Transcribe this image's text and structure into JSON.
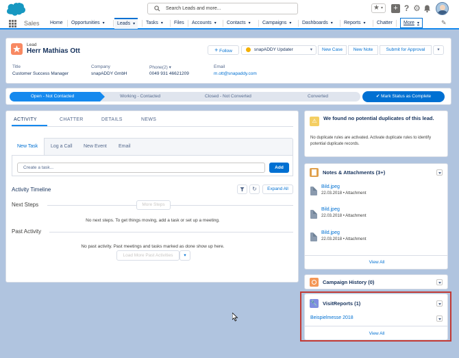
{
  "header": {
    "search_placeholder": "Search Leads and more...",
    "app_name": "Sales"
  },
  "nav": [
    {
      "label": "Home",
      "chevron": false
    },
    {
      "label": "Opportunities",
      "chevron": true
    },
    {
      "label": "Leads",
      "chevron": true,
      "active": true
    },
    {
      "label": "Tasks",
      "chevron": true
    },
    {
      "label": "Files",
      "chevron": false
    },
    {
      "label": "Accounts",
      "chevron": true
    },
    {
      "label": "Contacts",
      "chevron": true
    },
    {
      "label": "Campaigns",
      "chevron": true
    },
    {
      "label": "Dashboards",
      "chevron": true
    },
    {
      "label": "Reports",
      "chevron": true
    },
    {
      "label": "Chatter",
      "chevron": false
    },
    {
      "label": "More",
      "chevron": true
    }
  ],
  "record": {
    "type_label": "Lead",
    "name": "Herr Mathias Ott",
    "actions": {
      "follow": "Follow",
      "snapaddy": "snapADDY Updater",
      "new_case": "New Case",
      "new_note": "New Note",
      "submit": "Submit for Approval"
    },
    "fields": {
      "title_label": "Title",
      "title_value": "Customer Success Manager",
      "company_label": "Company",
      "company_value": "snapADDY GmbH",
      "phone_label": "Phone(2)",
      "phone_value": "0049 931 46621209",
      "email_label": "Email",
      "email_value": "m.ott@snapaddy.com"
    }
  },
  "path": {
    "steps": [
      "Open - Not Contacted",
      "Working - Contacted",
      "Closed - Not Converted",
      "Converted"
    ],
    "active_index": 0,
    "mark_button": "Mark Status as Complete"
  },
  "activity": {
    "tabs": [
      "ACTIVITY",
      "CHATTER",
      "DETAILS",
      "NEWS"
    ],
    "subtabs": [
      "New Task",
      "Log a Call",
      "New Event",
      "Email"
    ],
    "task_placeholder": "Create a task...",
    "add_button": "Add",
    "timeline_title": "Activity Timeline",
    "expand_all": "Expand All",
    "next_steps_title": "Next Steps",
    "more_steps": "More Steps",
    "no_next_steps": "No next steps. To get things moving, add a task or set up a meeting.",
    "past_activity_title": "Past Activity",
    "no_past_activity": "No past activity. Past meetings and tasks marked as done show up here.",
    "load_more": "Load More Past Activities"
  },
  "duplicates": {
    "title": "We found no potential duplicates of this lead.",
    "body": "No duplicate rules are activated. Activate duplicate rules to identify potential duplicate records."
  },
  "notes": {
    "title": "Notes & Attachments (3+)",
    "items": [
      {
        "name": "Bild.jpeg",
        "meta": "22.03.2018 • Attachment"
      },
      {
        "name": "Bild.jpeg",
        "meta": "22.03.2018 • Attachment"
      },
      {
        "name": "Bild.jpeg",
        "meta": "22.03.2018 • Attachment"
      }
    ],
    "view_all": "View All"
  },
  "campaign": {
    "title": "Campaign History (0)"
  },
  "visitreports": {
    "title": "VisitReports (1)",
    "item": "Beispielmesse 2018",
    "view_all": "View All"
  },
  "colors": {
    "brand_blue": "#0070d2",
    "path_active": "#1589ee",
    "lead_orange": "#f88962",
    "highlight_red": "#c23934",
    "notes_icon": "#e0a04c",
    "campaign_icon": "#f49756",
    "visit_icon": "#7f8de1"
  }
}
